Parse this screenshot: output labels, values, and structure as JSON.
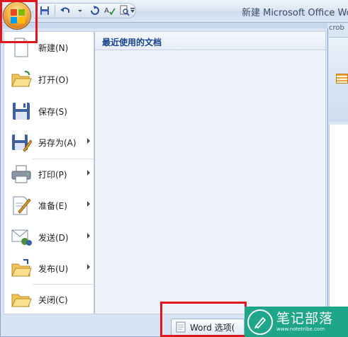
{
  "window": {
    "title": "新建 Microsoft Office Wo",
    "bg_tab": "crob"
  },
  "quick_access": {
    "items": [
      "save-icon",
      "undo-icon",
      "redo-icon",
      "spelling-icon",
      "print-preview-icon"
    ]
  },
  "office_button": {
    "icon": "office-logo-icon"
  },
  "menu": {
    "items": [
      {
        "label": "新建(N)",
        "icon": "new-document-icon",
        "submenu": false
      },
      {
        "label": "打开(O)",
        "icon": "open-folder-icon",
        "submenu": false
      },
      {
        "label": "保存(S)",
        "icon": "save-disk-icon",
        "submenu": false
      },
      {
        "label": "另存为(A)",
        "icon": "save-as-icon",
        "submenu": true
      },
      {
        "label": "打印(P)",
        "icon": "printer-icon",
        "submenu": true
      },
      {
        "label": "准备(E)",
        "icon": "prepare-icon",
        "submenu": true
      },
      {
        "label": "发送(D)",
        "icon": "send-icon",
        "submenu": true
      },
      {
        "label": "发布(U)",
        "icon": "publish-icon",
        "submenu": true
      },
      {
        "label": "关闭(C)",
        "icon": "close-folder-icon",
        "submenu": false
      }
    ],
    "recent_header": "最近使用的文档",
    "word_options_label": "Word 选项("
  },
  "watermark": {
    "main": "笔记部落",
    "sub": "www.notetribe.com"
  },
  "colors": {
    "highlight_box": "#e0161d",
    "recent_header_text": "#15428b",
    "watermark_bg": "#1ea58a"
  }
}
